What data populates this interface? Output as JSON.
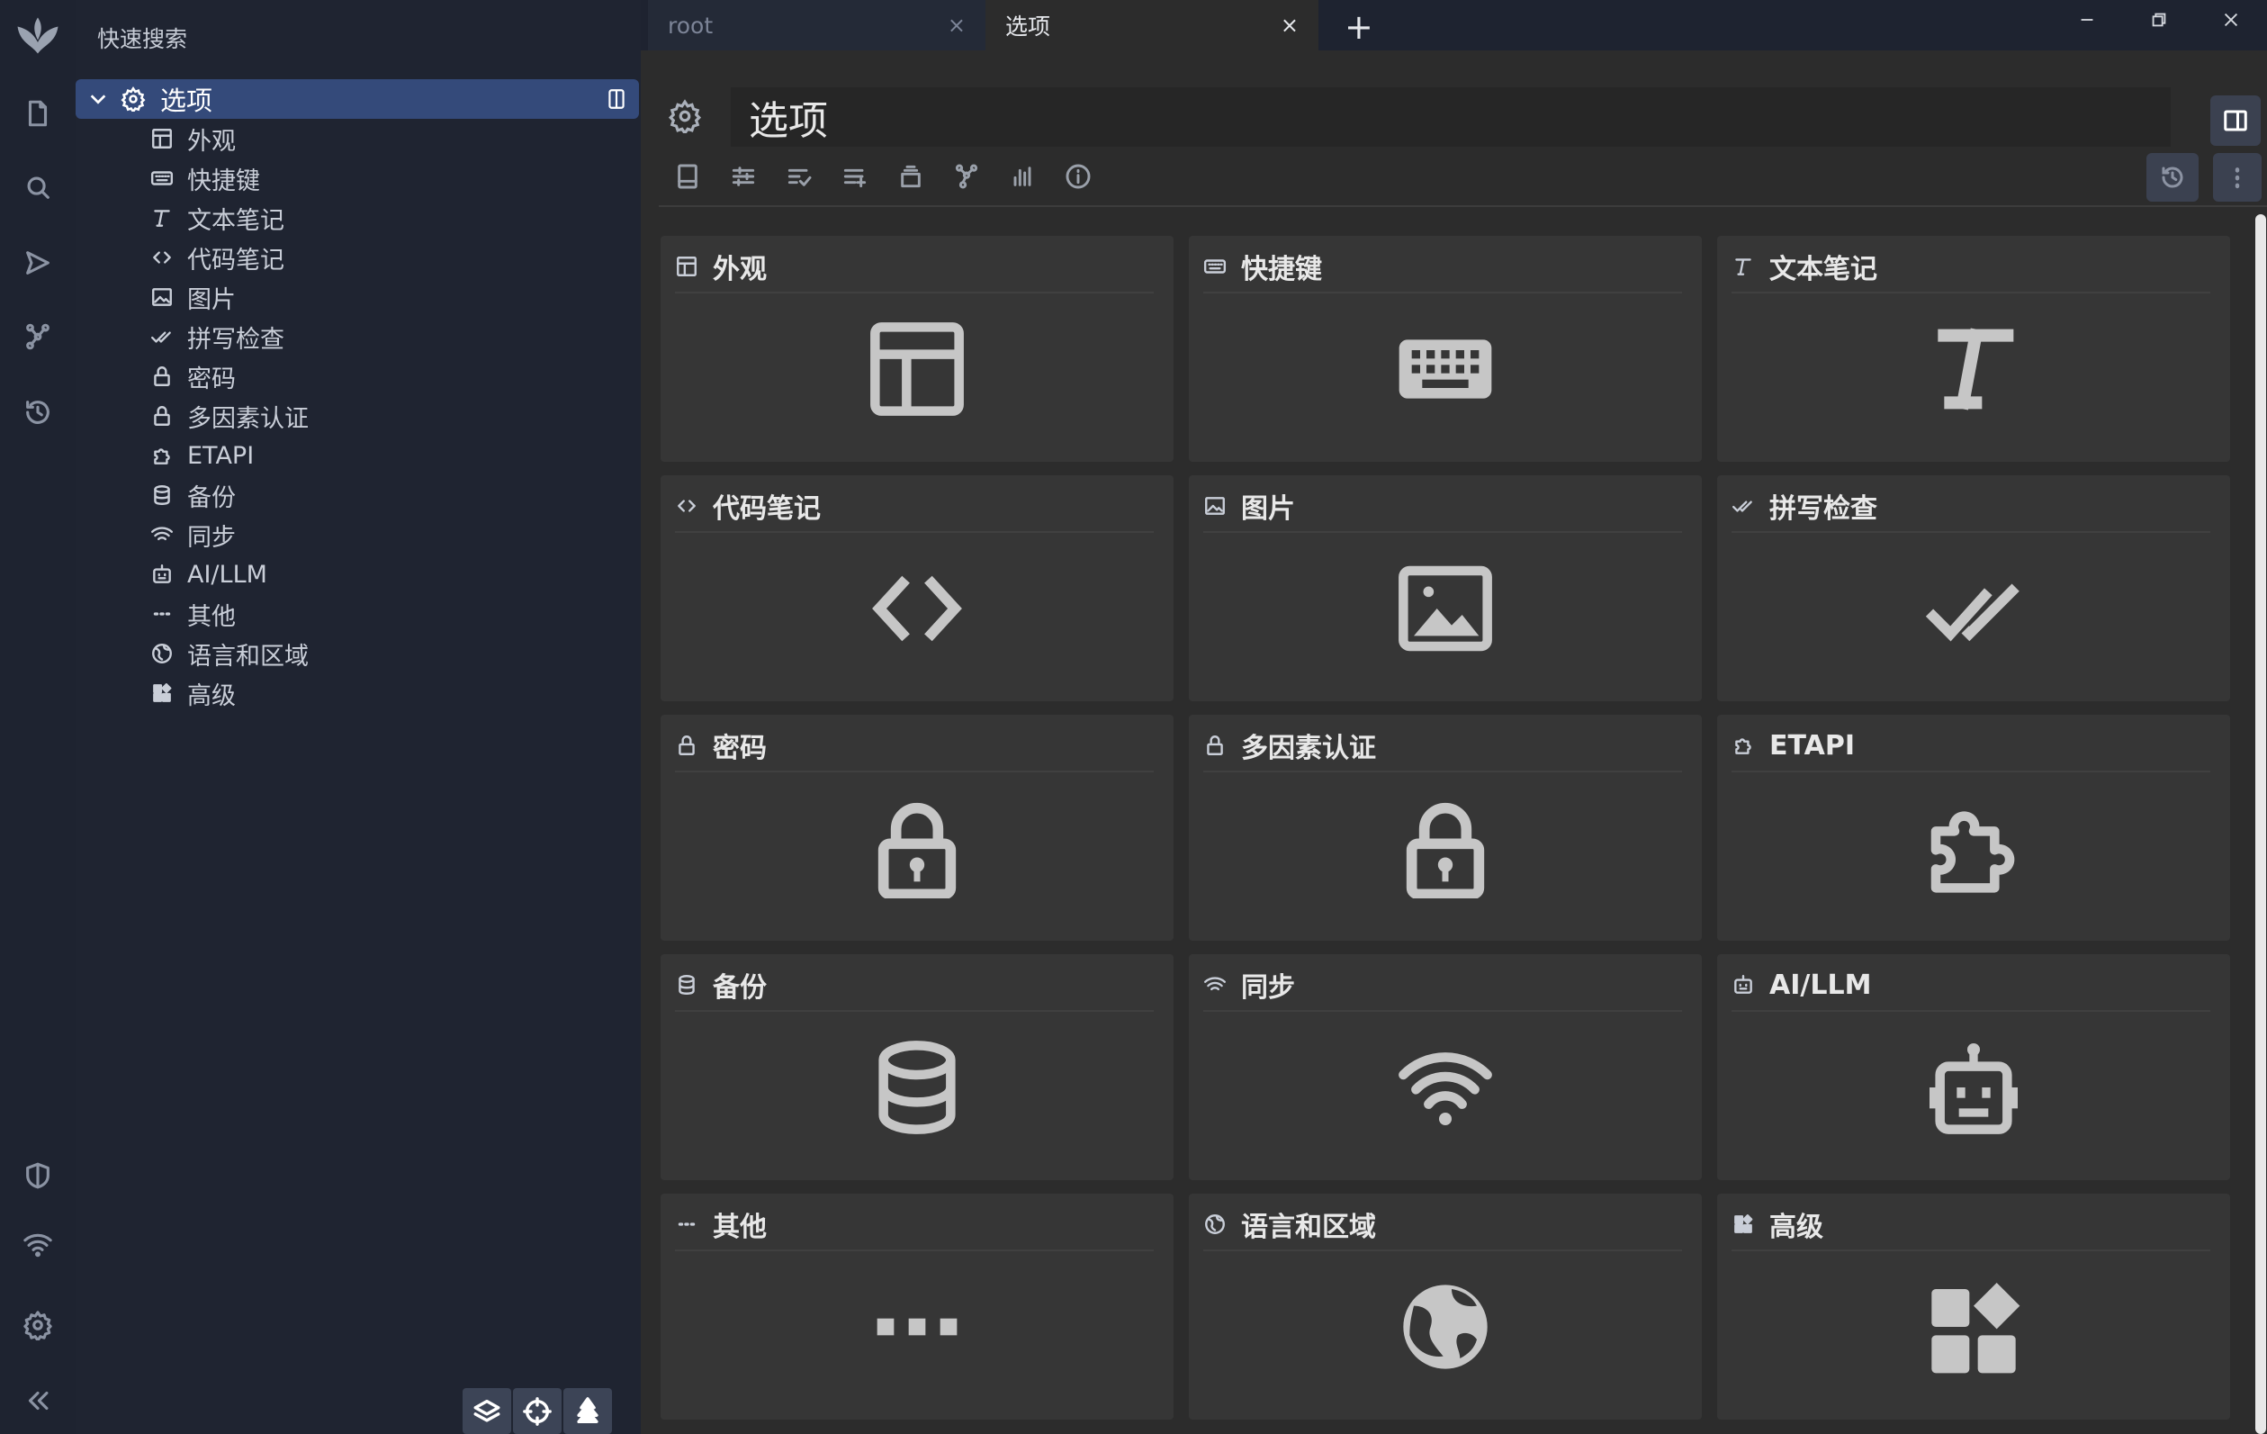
{
  "tree": {
    "quick_search": "快速搜索",
    "root": "选项",
    "items": [
      "外观",
      "快捷键",
      "文本笔记",
      "代码笔记",
      "图片",
      "拼写检查",
      "密码",
      "多因素认证",
      "ETAPI",
      "备份",
      "同步",
      "AI/LLM",
      "其他",
      "语言和区域",
      "高级"
    ]
  },
  "tabs": [
    {
      "title": "root",
      "close": "×",
      "active": false
    },
    {
      "title": "选项",
      "close": "×",
      "active": true
    }
  ],
  "new_tab": "+",
  "note": {
    "title": "选项"
  },
  "cards": [
    {
      "label": "外观",
      "icon": "layout-icon"
    },
    {
      "label": "快捷键",
      "icon": "keyboard-icon"
    },
    {
      "label": "文本笔记",
      "icon": "text-icon"
    },
    {
      "label": "代码笔记",
      "icon": "code-icon"
    },
    {
      "label": "图片",
      "icon": "image-icon"
    },
    {
      "label": "拼写检查",
      "icon": "double-check-icon"
    },
    {
      "label": "密码",
      "icon": "lock-icon"
    },
    {
      "label": "多因素认证",
      "icon": "lock-icon"
    },
    {
      "label": "ETAPI",
      "icon": "puzzle-icon"
    },
    {
      "label": "备份",
      "icon": "database-icon"
    },
    {
      "label": "同步",
      "icon": "wifi-icon"
    },
    {
      "label": "AI/LLM",
      "icon": "bot-icon"
    },
    {
      "label": "其他",
      "icon": "dots-icon"
    },
    {
      "label": "语言和区域",
      "icon": "globe-icon"
    },
    {
      "label": "高级",
      "icon": "widgets-icon"
    }
  ],
  "colors": {
    "accent": "#344a7a",
    "card": "#363636",
    "pane": "#2c2c2c"
  }
}
